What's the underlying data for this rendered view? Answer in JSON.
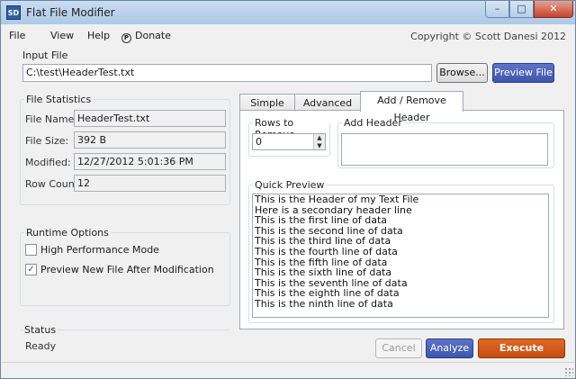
{
  "window": {
    "title": "Flat File Modifier",
    "icon_text": "SD",
    "controls": {
      "minimize": "–",
      "maximize": "□",
      "close": "✕"
    }
  },
  "menu": {
    "items": [
      "File",
      "View",
      "Help",
      "Donate"
    ],
    "copyright": "Copyright © Scott Danesi 2012"
  },
  "input_file": {
    "legend": "Input File",
    "path": "C:\\test\\HeaderTest.txt",
    "browse_label": "Browse...",
    "preview_label": "Preview File"
  },
  "file_statistics": {
    "legend": "File Statistics",
    "fields": [
      {
        "label": "File Name:",
        "value": "HeaderTest.txt"
      },
      {
        "label": "File Size:",
        "value": "392 B"
      },
      {
        "label": "Modified:",
        "value": "12/27/2012 5:01:36 PM"
      },
      {
        "label": "Row Count:",
        "value": "12"
      }
    ]
  },
  "runtime_options": {
    "legend": "Runtime Options",
    "options": [
      {
        "label": "High Performance Mode",
        "checked": false
      },
      {
        "label": "Preview New File After Modification",
        "checked": true
      }
    ]
  },
  "status": {
    "legend": "Status",
    "text": "Ready"
  },
  "tabs": {
    "items": [
      "Simple Find",
      "Advanced Find",
      "Add / Remove Header"
    ],
    "active_index": 2
  },
  "header_tab": {
    "rows_to_remove_legend": "Rows to Remove",
    "rows_to_remove_value": "0",
    "add_header_legend": "Add Header",
    "add_header_value": "",
    "quick_preview_legend": "Quick Preview",
    "preview_lines": [
      "This is the Header of my Text File",
      "Here is a secondary header line",
      "This is the first line of data",
      "This is the second line of data",
      "This is the third line of data",
      "This is the fourth line of data",
      "This is the fifth line of data",
      "This is the sixth line of data",
      "This is the seventh line of data",
      "This is the eighth line of data",
      "This is the ninth line of data"
    ]
  },
  "actions": {
    "cancel_label": "Cancel",
    "analyze_label": "Analyze",
    "execute_label": "Execute"
  }
}
